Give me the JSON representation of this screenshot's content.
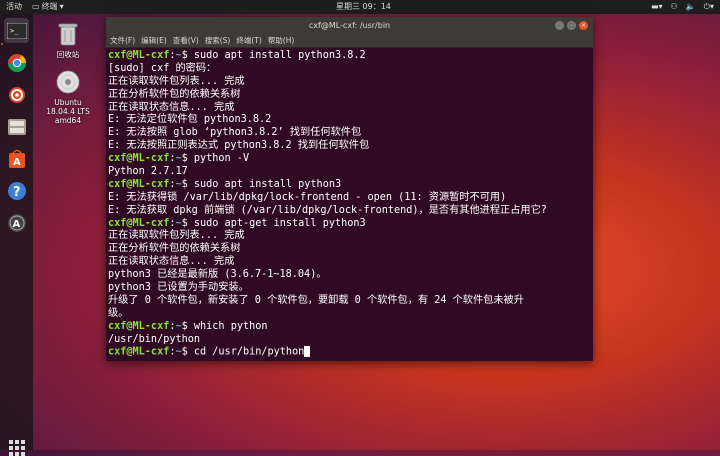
{
  "topbar": {
    "activities": "活动",
    "app_menu": "终端",
    "clock": "星期三 09：14"
  },
  "desktop": {
    "trash_label": "回收站",
    "disc_label_1": "Ubuntu",
    "disc_label_2": "18.04.4 LTS",
    "disc_label_3": "amd64"
  },
  "terminal": {
    "title": "cxf@ML-cxf: /usr/bin",
    "menu": [
      "文件(F)",
      "编辑(E)",
      "查看(V)",
      "搜索(S)",
      "终端(T)",
      "帮助(H)"
    ],
    "prompt_user": "cxf@ML-cxf",
    "prompt_path": "~",
    "lines": [
      {
        "type": "cmd",
        "cmd": "sudo apt install python3.8.2"
      },
      {
        "type": "out",
        "text": "[sudo] cxf 的密码："
      },
      {
        "type": "out",
        "text": "正在读取软件包列表... 完成"
      },
      {
        "type": "out",
        "text": "正在分析软件包的依赖关系树"
      },
      {
        "type": "out",
        "text": "正在读取状态信息... 完成"
      },
      {
        "type": "out",
        "text": "E: 无法定位软件包 python3.8.2"
      },
      {
        "type": "out",
        "text": "E: 无法按照 glob ‘python3.8.2’ 找到任何软件包"
      },
      {
        "type": "out",
        "text": "E: 无法按照正则表达式 python3.8.2 找到任何软件包"
      },
      {
        "type": "cmd",
        "cmd": "python -V"
      },
      {
        "type": "out",
        "text": "Python 2.7.17"
      },
      {
        "type": "cmd",
        "cmd": "sudo apt install python3"
      },
      {
        "type": "out",
        "text": "E: 无法获得锁 /var/lib/dpkg/lock-frontend - open (11: 资源暂时不可用)"
      },
      {
        "type": "out",
        "text": "E: 无法获取 dpkg 前端锁 (/var/lib/dpkg/lock-frontend)，是否有其他进程正占用它?"
      },
      {
        "type": "cmd",
        "cmd": "sudo apt-get install python3"
      },
      {
        "type": "out",
        "text": "正在读取软件包列表... 完成"
      },
      {
        "type": "out",
        "text": "正在分析软件包的依赖关系树"
      },
      {
        "type": "out",
        "text": "正在读取状态信息... 完成"
      },
      {
        "type": "out",
        "text": "python3 已经是最新版 (3.6.7-1~18.04)。"
      },
      {
        "type": "out",
        "text": "python3 已设置为手动安装。"
      },
      {
        "type": "out",
        "text": "升级了 0 个软件包，新安装了 0 个软件包，要卸载 0 个软件包，有 24 个软件包未被升"
      },
      {
        "type": "out",
        "text": "级。"
      },
      {
        "type": "cmd",
        "cmd": "which python"
      },
      {
        "type": "out",
        "text": "/usr/bin/python"
      },
      {
        "type": "cmd",
        "cmd": "cd /usr/bin/python"
      }
    ]
  },
  "colors": {
    "terminal_bg": "#300a24",
    "prompt_user": "#8ae234",
    "prompt_path": "#729fcf",
    "accent": "#e95420"
  }
}
